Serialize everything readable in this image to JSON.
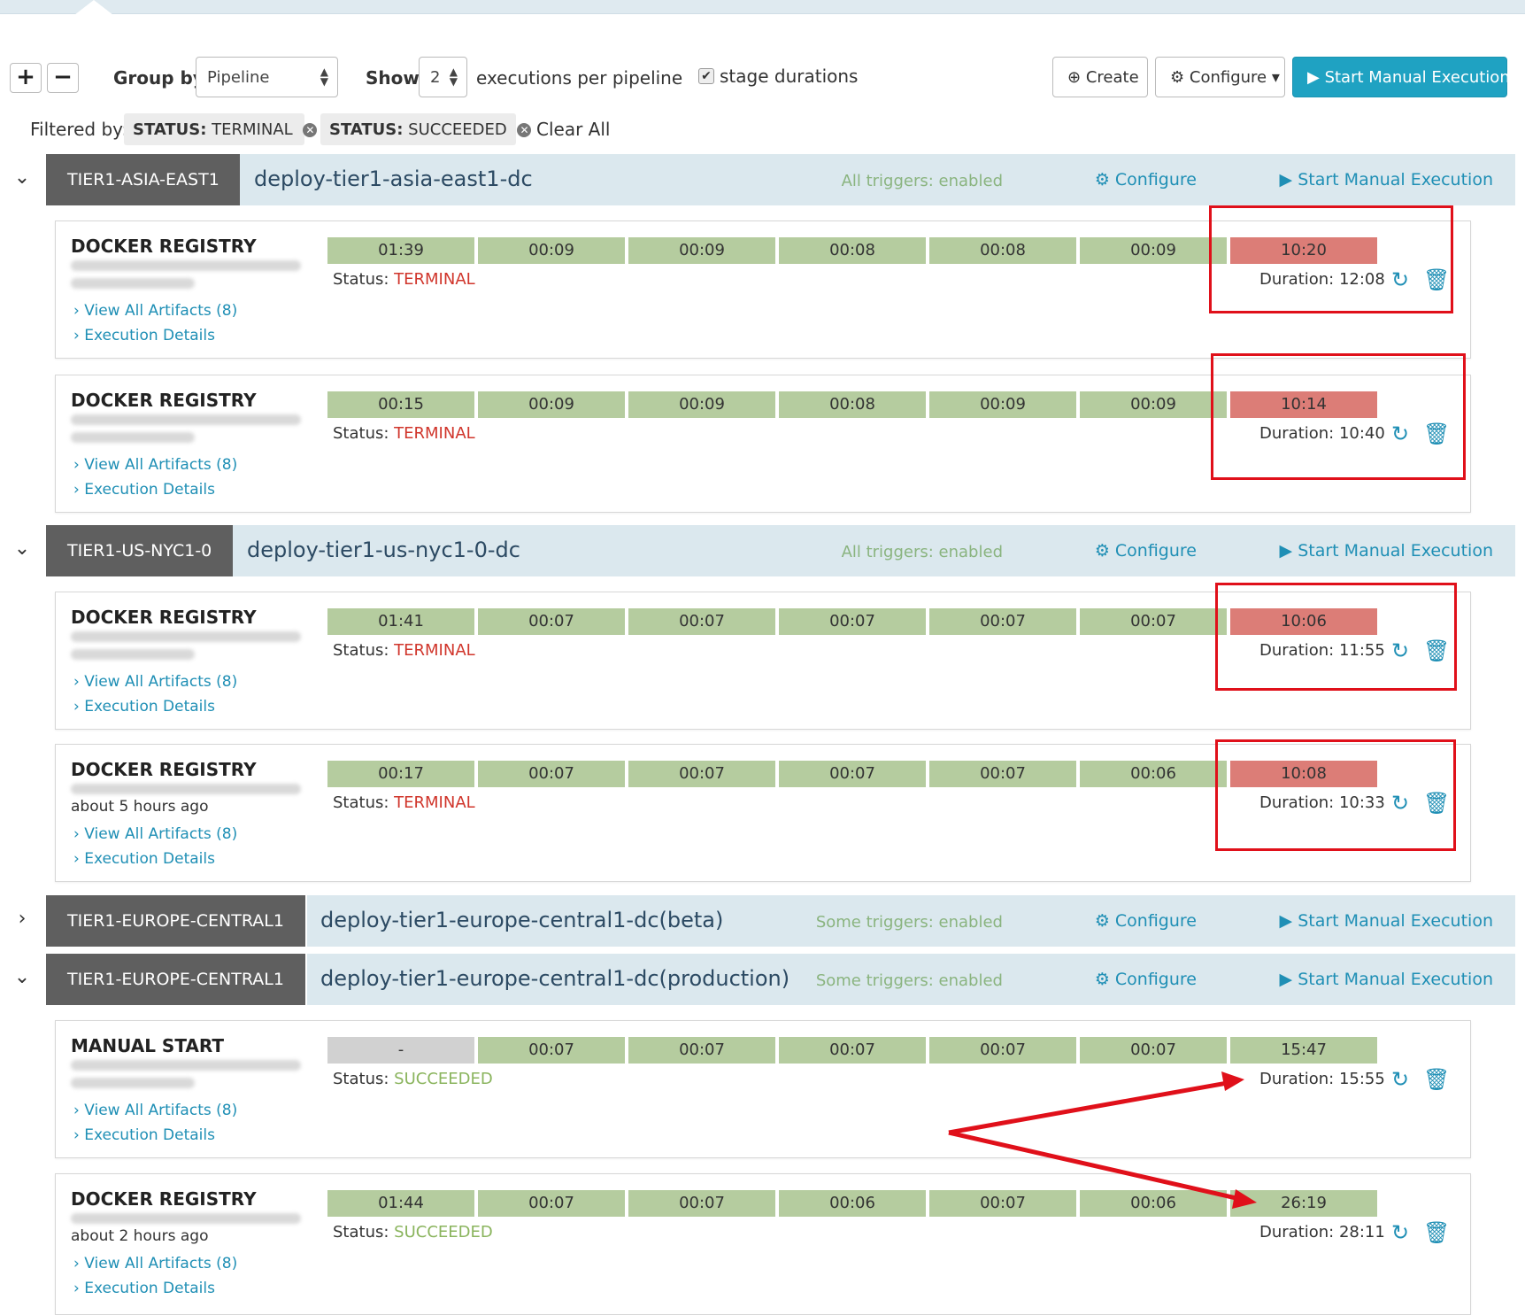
{
  "toolbar": {
    "expand_label": "+",
    "collapse_label": "−",
    "group_by_label": "Group by",
    "group_by_value": "Pipeline",
    "show_label": "Show",
    "show_value": "2",
    "executions_label": "executions per pipeline",
    "stage_durations_label": "stage durations",
    "stage_durations_checked": true,
    "create_label": "Create",
    "configure_label": "Configure",
    "start_manual_label": "Start Manual Execution",
    "accent_color": "#1fa2c2"
  },
  "filters": {
    "label": "Filtered by:",
    "chips": [
      {
        "key": "STATUS:",
        "value": "TERMINAL"
      },
      {
        "key": "STATUS:",
        "value": "SUCCEEDED"
      }
    ],
    "clear_all": "Clear All"
  },
  "groups": [
    {
      "expanded": true,
      "tag": "TIER1-ASIA-EAST1",
      "pipeline": "deploy-tier1-asia-east1-dc",
      "triggers": "All triggers: enabled",
      "configure": "Configure",
      "start_manual": "Start Manual Execution",
      "executions": [
        {
          "trigger": "DOCKER REGISTRY",
          "ago": "",
          "stages": [
            "01:39",
            "00:09",
            "00:09",
            "00:08",
            "00:08",
            "00:09",
            "10:20"
          ],
          "stage_status": [
            "ok",
            "ok",
            "ok",
            "ok",
            "ok",
            "ok",
            "terminal"
          ],
          "status_label": "Status:",
          "status": "TERMINAL",
          "duration": "Duration: 12:08",
          "artifacts": "View All Artifacts (8)",
          "details": "Execution Details"
        },
        {
          "trigger": "DOCKER REGISTRY",
          "ago": "",
          "stages": [
            "00:15",
            "00:09",
            "00:09",
            "00:08",
            "00:09",
            "00:09",
            "10:14"
          ],
          "stage_status": [
            "ok",
            "ok",
            "ok",
            "ok",
            "ok",
            "ok",
            "terminal"
          ],
          "status_label": "Status:",
          "status": "TERMINAL",
          "duration": "Duration: 10:40",
          "artifacts": "View All Artifacts (8)",
          "details": "Execution Details"
        }
      ]
    },
    {
      "expanded": true,
      "tag": "TIER1-US-NYC1-0",
      "pipeline": "deploy-tier1-us-nyc1-0-dc",
      "triggers": "All triggers: enabled",
      "configure": "Configure",
      "start_manual": "Start Manual Execution",
      "executions": [
        {
          "trigger": "DOCKER REGISTRY",
          "ago": "",
          "stages": [
            "01:41",
            "00:07",
            "00:07",
            "00:07",
            "00:07",
            "00:07",
            "10:06"
          ],
          "stage_status": [
            "ok",
            "ok",
            "ok",
            "ok",
            "ok",
            "ok",
            "terminal"
          ],
          "status_label": "Status:",
          "status": "TERMINAL",
          "duration": "Duration: 11:55",
          "artifacts": "View All Artifacts (8)",
          "details": "Execution Details"
        },
        {
          "trigger": "DOCKER REGISTRY",
          "ago": "about 5 hours ago",
          "stages": [
            "00:17",
            "00:07",
            "00:07",
            "00:07",
            "00:07",
            "00:06",
            "10:08"
          ],
          "stage_status": [
            "ok",
            "ok",
            "ok",
            "ok",
            "ok",
            "ok",
            "terminal"
          ],
          "status_label": "Status:",
          "status": "TERMINAL",
          "duration": "Duration: 10:33",
          "artifacts": "View All Artifacts (8)",
          "details": "Execution Details"
        }
      ]
    },
    {
      "expanded": false,
      "tag": "TIER1-EUROPE-CENTRAL1",
      "pipeline": "deploy-tier1-europe-central1-dc(beta)",
      "triggers": "Some triggers: enabled",
      "configure": "Configure",
      "start_manual": "Start Manual Execution",
      "executions": []
    },
    {
      "expanded": true,
      "tag": "TIER1-EUROPE-CENTRAL1",
      "pipeline": "deploy-tier1-europe-central1-dc(production)",
      "triggers": "Some triggers: enabled",
      "configure": "Configure",
      "start_manual": "Start Manual Execution",
      "executions": [
        {
          "trigger": "MANUAL START",
          "ago": "",
          "stages": [
            "-",
            "00:07",
            "00:07",
            "00:07",
            "00:07",
            "00:07",
            "15:47"
          ],
          "stage_status": [
            "skip",
            "ok",
            "ok",
            "ok",
            "ok",
            "ok",
            "ok"
          ],
          "status_label": "Status:",
          "status": "SUCCEEDED",
          "duration": "Duration: 15:55",
          "artifacts": "View All Artifacts (8)",
          "details": "Execution Details"
        },
        {
          "trigger": "DOCKER REGISTRY",
          "ago": "about 2 hours ago",
          "stages": [
            "01:44",
            "00:07",
            "00:07",
            "00:06",
            "00:07",
            "00:06",
            "26:19"
          ],
          "stage_status": [
            "ok",
            "ok",
            "ok",
            "ok",
            "ok",
            "ok",
            "ok"
          ],
          "status_label": "Status:",
          "status": "SUCCEEDED",
          "duration": "Duration: 28:11",
          "artifacts": "View All Artifacts (8)",
          "details": "Execution Details"
        }
      ]
    }
  ],
  "colors": {
    "stage_ok": "#b5cc9f",
    "stage_terminal": "#dc7d77",
    "stage_skipped": "#d1d1d1",
    "status_terminal": "#d0352b",
    "status_succeeded": "#8ab45d",
    "link": "#1f8fb5",
    "annotation": "#e0101a"
  },
  "icons": {
    "create": "plus-circle-icon",
    "configure": "gear-icon",
    "start": "play-icon",
    "rerun": "redo-icon",
    "delete": "trash-icon",
    "expand": "chevron-down-icon",
    "collapse": "chevron-right-icon"
  }
}
